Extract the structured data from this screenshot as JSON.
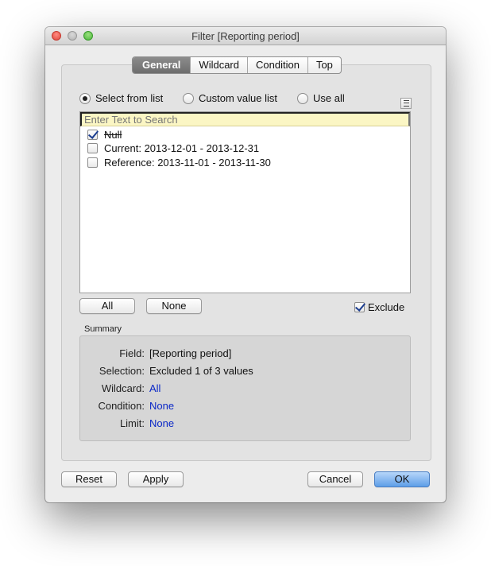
{
  "window": {
    "title": "Filter [Reporting period]"
  },
  "tabs": [
    {
      "label": "General",
      "active": true
    },
    {
      "label": "Wildcard",
      "active": false
    },
    {
      "label": "Condition",
      "active": false
    },
    {
      "label": "Top",
      "active": false
    }
  ],
  "mode_options": {
    "select_from_list": "Select from list",
    "custom_value_list": "Custom value list",
    "use_all": "Use all",
    "selected": "select_from_list"
  },
  "search": {
    "placeholder": "Enter Text to Search"
  },
  "list_items": [
    {
      "label": "Null",
      "checked": true
    },
    {
      "label": "Current: 2013-12-01 - 2013-12-31",
      "checked": false
    },
    {
      "label": "Reference: 2013-11-01 - 2013-11-30",
      "checked": false
    }
  ],
  "list_buttons": {
    "all": "All",
    "none": "None"
  },
  "exclude": {
    "label": "Exclude",
    "checked": true
  },
  "summary": {
    "heading": "Summary",
    "field_key": "Field:",
    "field_value": "[Reporting period]",
    "selection_key": "Selection:",
    "selection_value": "Excluded 1 of 3 values",
    "wildcard_key": "Wildcard:",
    "wildcard_value": "All",
    "condition_key": "Condition:",
    "condition_value": "None",
    "limit_key": "Limit:",
    "limit_value": "None"
  },
  "footer": {
    "reset": "Reset",
    "apply": "Apply",
    "cancel": "Cancel",
    "ok": "OK"
  },
  "colors": {
    "link": "#0b28c7",
    "primary_button": "#5e9ee8",
    "search_background": "#fbf6c4"
  }
}
